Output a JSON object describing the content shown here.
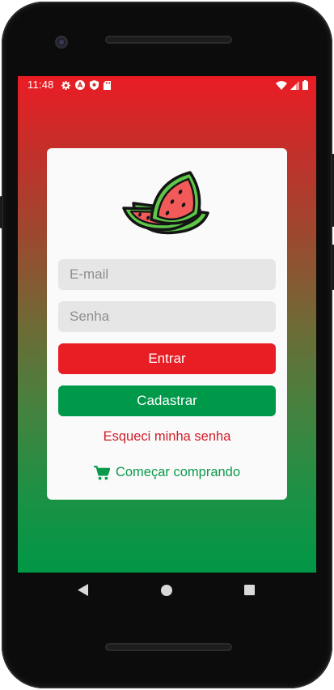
{
  "status_bar": {
    "time": "11:48"
  },
  "login": {
    "email_placeholder": "E-mail",
    "email_value": "",
    "password_placeholder": "Senha",
    "password_value": "",
    "login_button": "Entrar",
    "register_button": "Cadastrar",
    "forgot_password": "Esqueci minha senha",
    "start_shopping": "Começar comprando"
  },
  "icons": {
    "logo": "watermelon-icon",
    "shop": "cart-icon",
    "nav_back": "back-triangle-icon",
    "nav_home": "home-circle-icon",
    "nav_recent": "recents-square-icon"
  },
  "colors": {
    "gradient_top": "#ea1c24",
    "gradient_bottom": "#009746",
    "login_button": "#e91d24",
    "register_button": "#00994a",
    "forgot_link": "#d11e29",
    "shop_link": "#0a9a4b"
  }
}
